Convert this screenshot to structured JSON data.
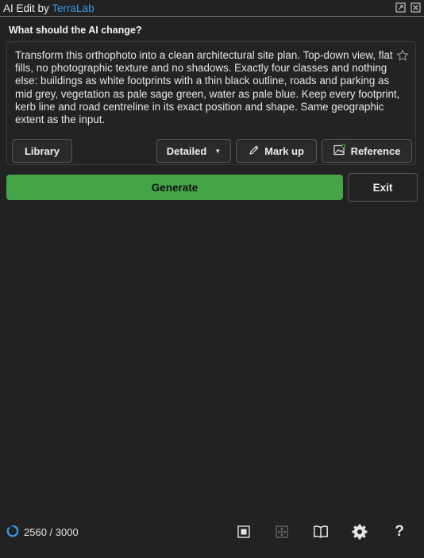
{
  "window": {
    "title_prefix": "AI Edit by ",
    "title_brand": "TerraLab",
    "brand_color": "#3d9ae8"
  },
  "prompt": {
    "label": "What should the AI change?",
    "text": "Transform this orthophoto into a clean architectural site plan. Top-down view, flat fills, no photographic texture and no shadows. Exactly four classes and nothing else: buildings as white footprints with a thin black outline, roads and parking as mid grey, vegetation as pale sage green, water as pale blue. Keep every footprint, kerb line and road centreline in its exact position and shape. Same geographic extent as the input."
  },
  "toolbar": {
    "library_label": "Library",
    "detail_label": "Detailed",
    "markup_label": "Mark up",
    "reference_label": "Reference"
  },
  "actions": {
    "generate_label": "Generate",
    "exit_label": "Exit",
    "generate_color": "#43a547"
  },
  "footer": {
    "credits": "2560 / 3000",
    "credits_used": 2560,
    "credits_total": 3000,
    "icons": [
      "frame-select-icon",
      "crop-move-icon",
      "book-icon",
      "gear-icon",
      "help-icon"
    ]
  }
}
